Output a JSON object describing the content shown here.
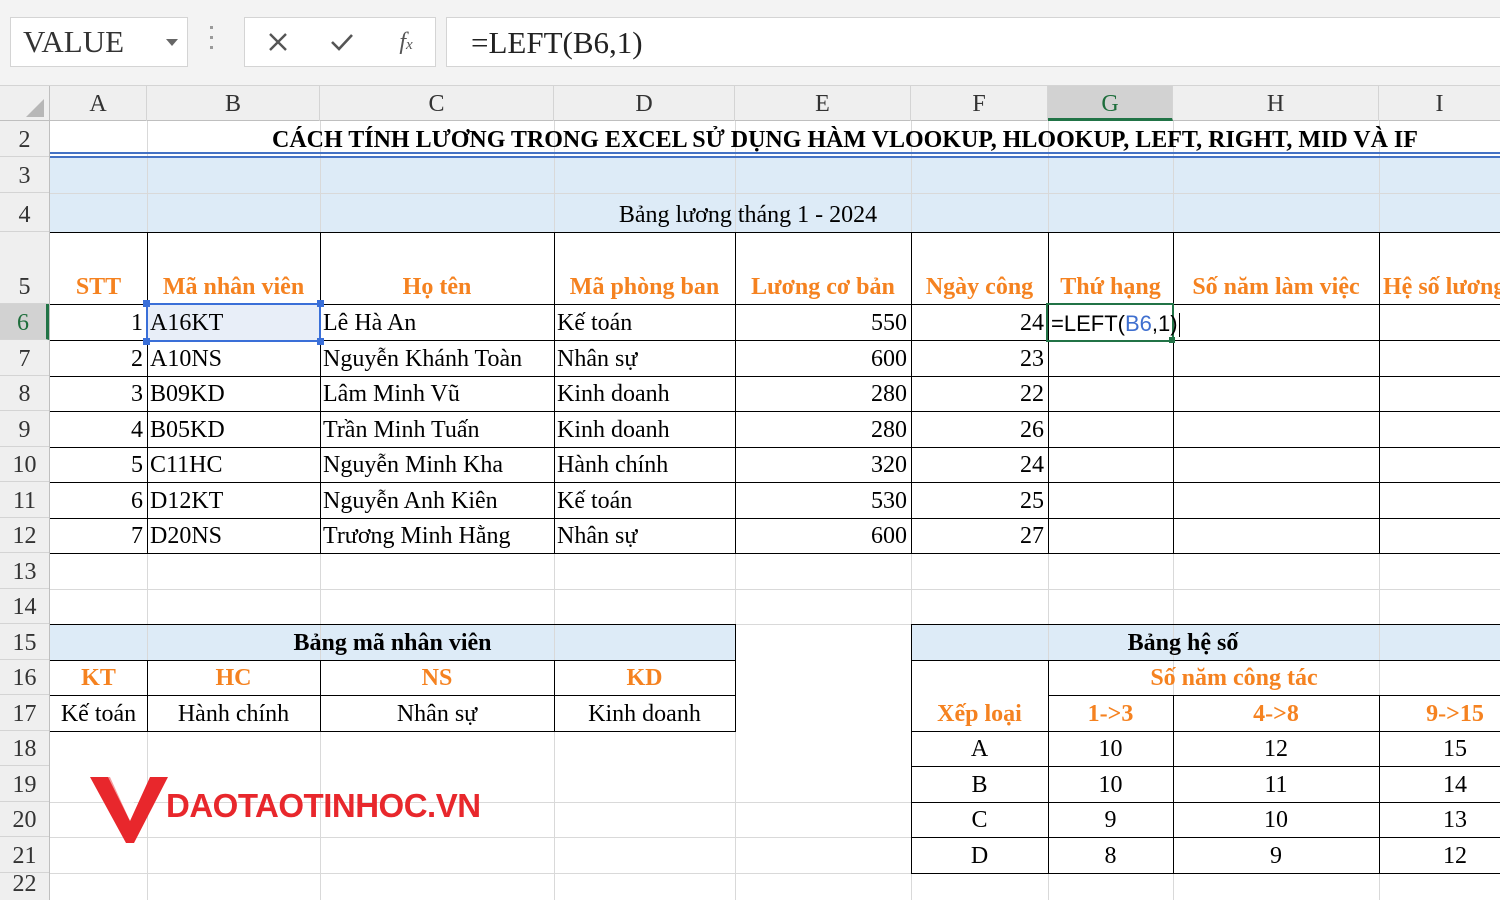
{
  "formula_bar": {
    "name_box": "VALUE",
    "formula": "=LEFT(B6,1)",
    "cancel_icon": "✕",
    "enter_icon": "✓",
    "fx_label": "fx"
  },
  "columns": [
    "A",
    "B",
    "C",
    "D",
    "E",
    "F",
    "G",
    "H",
    "I"
  ],
  "selected_column": "G",
  "rows": [
    "2",
    "3",
    "4",
    "5",
    "6",
    "7",
    "8",
    "9",
    "10",
    "11",
    "12",
    "13",
    "14",
    "15",
    "16",
    "17",
    "18",
    "19",
    "20",
    "21",
    "22"
  ],
  "selected_row": "6",
  "sheet": {
    "main_title": "CÁCH TÍNH LƯƠNG TRONG EXCEL SỬ DỤNG HÀM VLOOKUP, HLOOKUP, LEFT, RIGHT, MID VÀ IF",
    "subtitle": "Bảng lương tháng 1 - 2024",
    "headers": [
      "STT",
      "Mã nhân viên",
      "Họ tên",
      "Mã phòng ban",
      "Lương cơ bản",
      "Ngày công",
      "Thứ hạng",
      "Số năm làm việc",
      "Hệ số lương"
    ],
    "employees": [
      {
        "stt": "1",
        "code": "A16KT",
        "name": "Lê Hà An",
        "dept": "Kế toán",
        "salary": "550",
        "days": "24"
      },
      {
        "stt": "2",
        "code": "A10NS",
        "name": "Nguyễn Khánh Toàn",
        "dept": "Nhân sự",
        "salary": "600",
        "days": "23"
      },
      {
        "stt": "3",
        "code": "B09KD",
        "name": "Lâm Minh Vũ",
        "dept": "Kinh doanh",
        "salary": "280",
        "days": "22"
      },
      {
        "stt": "4",
        "code": "B05KD",
        "name": "Trần Minh Tuấn",
        "dept": "Kinh doanh",
        "salary": "280",
        "days": "26"
      },
      {
        "stt": "5",
        "code": "C11HC",
        "name": "Nguyễn Minh Kha",
        "dept": "Hành chính",
        "salary": "320",
        "days": "24"
      },
      {
        "stt": "6",
        "code": "D12KT",
        "name": "Nguyễn Anh Kiên",
        "dept": "Kế toán",
        "salary": "530",
        "days": "25"
      },
      {
        "stt": "7",
        "code": "D20NS",
        "name": "Trương Minh Hằng",
        "dept": "Nhân sự",
        "salary": "600",
        "days": "27"
      }
    ],
    "editing_cell": {
      "prefix": "=LEFT(",
      "ref": "B6",
      "suffix": ",1)"
    },
    "code_table": {
      "title": "Bảng mã nhân viên",
      "codes": [
        "KT",
        "HC",
        "NS",
        "KD"
      ],
      "names": [
        "Kế toán",
        "Hành chính",
        "Nhân sự",
        "Kinh doanh"
      ]
    },
    "coef_table": {
      "title": "Bảng hệ số",
      "years_label": "Số năm công tác",
      "rank_label": "Xếp loại",
      "ranges": [
        "1->3",
        "4->8",
        "9->15"
      ],
      "rows": [
        {
          "rank": "A",
          "v": [
            "10",
            "12",
            "15"
          ]
        },
        {
          "rank": "B",
          "v": [
            "10",
            "11",
            "14"
          ]
        },
        {
          "rank": "C",
          "v": [
            "9",
            "10",
            "13"
          ]
        },
        {
          "rank": "D",
          "v": [
            "8",
            "9",
            "12"
          ]
        }
      ]
    }
  },
  "logo": {
    "text": "DAOTAOTINHOC.VN",
    "color": "#e8272c"
  }
}
